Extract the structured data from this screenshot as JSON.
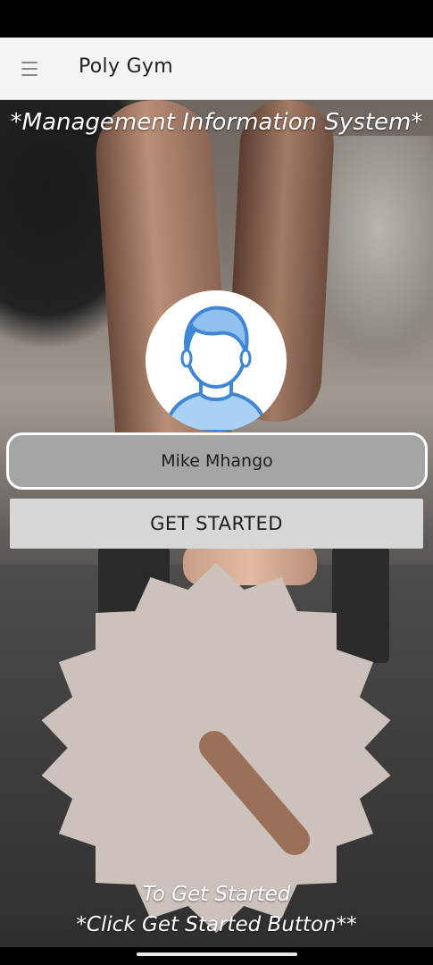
{
  "app": {
    "title": "Poly Gym"
  },
  "hero": {
    "subtitle": "*Management Information System*"
  },
  "profile": {
    "name": "Mike Mhango",
    "avatar_icon": "user-avatar-icon"
  },
  "actions": {
    "get_started_label": "GET STARTED"
  },
  "hint": {
    "line1": "To Get Started",
    "line2": "*Click Get Started Button**"
  },
  "colors": {
    "app_bar": "#f4f4f4",
    "name_pill": "#a5a5a5",
    "button": "#d7d7d7",
    "badge": "#cdc1bb",
    "avatar_accent": "#8fc0ee"
  }
}
